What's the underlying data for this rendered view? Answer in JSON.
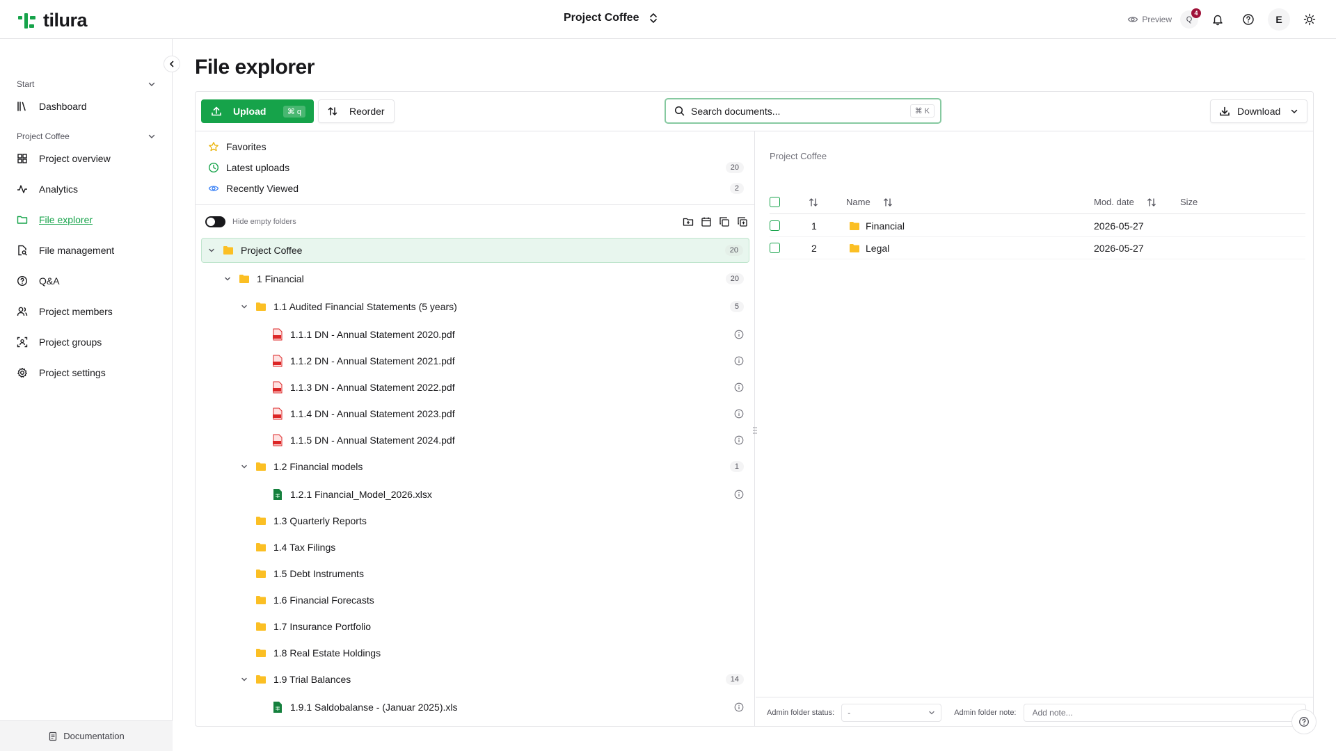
{
  "app": {
    "brand": "tilura",
    "brand_color": "#16a34a",
    "current_project": "Project Coffee"
  },
  "header": {
    "preview_label": "Preview",
    "notifications_count": "4",
    "avatar_initial": "E"
  },
  "sidebar": {
    "sections": [
      {
        "title": "Start",
        "items": [
          {
            "label": "Dashboard",
            "icon": "books-icon"
          }
        ]
      },
      {
        "title": "Project Coffee",
        "items": [
          {
            "label": "Project overview",
            "icon": "grid-icon"
          },
          {
            "label": "Analytics",
            "icon": "activity-icon"
          },
          {
            "label": "File explorer",
            "icon": "folder-icon",
            "active": true
          },
          {
            "label": "File management",
            "icon": "file-search-icon"
          },
          {
            "label": "Q&A",
            "icon": "help-circle-icon"
          },
          {
            "label": "Project members",
            "icon": "users-icon"
          },
          {
            "label": "Project groups",
            "icon": "group-icon"
          },
          {
            "label": "Project settings",
            "icon": "gear-icon"
          }
        ]
      }
    ],
    "footer_label": "Documentation"
  },
  "page": {
    "title": "File explorer"
  },
  "toolbar": {
    "upload_label": "Upload",
    "upload_shortcut": "⌘ q",
    "reorder_label": "Reorder",
    "search_placeholder": "Search documents...",
    "search_shortcut": "⌘ K",
    "download_label": "Download"
  },
  "quick_links": [
    {
      "label": "Favorites",
      "count": ""
    },
    {
      "label": "Latest uploads",
      "count": "20"
    },
    {
      "label": "Recently Viewed",
      "count": "2"
    }
  ],
  "tree_options": {
    "hide_empty_label": "Hide empty folders"
  },
  "tree": [
    {
      "type": "folder",
      "label": "Project Coffee",
      "count": "20",
      "expanded": true,
      "depth": 0
    },
    {
      "type": "folder",
      "label": "1 Financial",
      "count": "20",
      "expanded": true,
      "depth": 1
    },
    {
      "type": "folder",
      "label": "1.1 Audited Financial Statements (5 years)",
      "count": "5",
      "expanded": true,
      "depth": 2
    },
    {
      "type": "pdf",
      "label": "1.1.1 DN - Annual Statement 2020.pdf",
      "depth": 3
    },
    {
      "type": "pdf",
      "label": "1.1.2 DN - Annual Statement 2021.pdf",
      "depth": 3
    },
    {
      "type": "pdf",
      "label": "1.1.3 DN - Annual Statement 2022.pdf",
      "depth": 3
    },
    {
      "type": "pdf",
      "label": "1.1.4 DN - Annual Statement 2023.pdf",
      "depth": 3
    },
    {
      "type": "pdf",
      "label": "1.1.5 DN - Annual Statement 2024.pdf",
      "depth": 3
    },
    {
      "type": "folder",
      "label": "1.2 Financial models",
      "count": "1",
      "expanded": true,
      "depth": 2
    },
    {
      "type": "xlsx",
      "label": "1.2.1 Financial_Model_2026.xlsx",
      "depth": 3
    },
    {
      "type": "folder",
      "label": "1.3 Quarterly Reports",
      "depth": 2
    },
    {
      "type": "folder",
      "label": "1.4 Tax Filings",
      "depth": 2
    },
    {
      "type": "folder",
      "label": "1.5 Debt Instruments",
      "depth": 2
    },
    {
      "type": "folder",
      "label": "1.6 Financial Forecasts",
      "depth": 2
    },
    {
      "type": "folder",
      "label": "1.7 Insurance Portfolio",
      "depth": 2
    },
    {
      "type": "folder",
      "label": "1.8 Real Estate Holdings",
      "depth": 2
    },
    {
      "type": "folder",
      "label": "1.9 Trial Balances",
      "count": "14",
      "expanded": true,
      "depth": 2
    },
    {
      "type": "xlsx",
      "label": "1.9.1 Saldobalanse - (Januar 2025).xls",
      "depth": 3
    }
  ],
  "content": {
    "breadcrumb": "Project Coffee",
    "columns": {
      "name": "Name",
      "mod_date": "Mod. date",
      "size": "Size"
    },
    "rows": [
      {
        "index": "1",
        "name": "Financial",
        "mod_date": "2026-05-27",
        "size": ""
      },
      {
        "index": "2",
        "name": "Legal",
        "mod_date": "2026-05-27",
        "size": ""
      }
    ],
    "admin_status_label": "Admin folder status:",
    "admin_status_value": "-",
    "admin_note_label": "Admin folder note:",
    "admin_note_placeholder": "Add note..."
  },
  "colors": {
    "folder": "#fbbf24",
    "pdf": "#dc2626",
    "xlsx": "#15803d",
    "accent": "#16a34a",
    "badge": "#9f1239"
  }
}
